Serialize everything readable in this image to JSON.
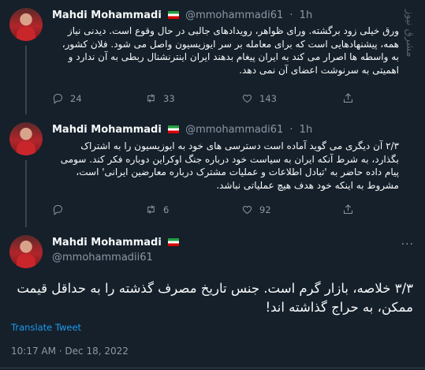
{
  "tweets": [
    {
      "name": "Mahdi Mohammadi",
      "handle": "@mmohammadi61",
      "time": "1h",
      "text": "ورق خیلی زود برگشته. ورای ظواهر، رویدادهای جالبی در حال وقوع است. دیدنی نیاز همه، پیشنهادهایی است که برای معامله بر سر ایوزیسیون واصل می شود. فلان کشور، به واسطه ها اصرار می کند به ایران پیغام بدهند ایران اینترنشنال ربطی به آن ندارد و اهمیتی به سرنوشت اعضای آن نمی دهد.",
      "replies": "24",
      "retweets": "33",
      "likes": "143"
    },
    {
      "name": "Mahdi Mohammadi",
      "handle": "@mmohammadi61",
      "time": "1h",
      "text": "۲/۳ آن دیگری می گوید آماده است دسترسی های خود به ایوزیسیون را به اشتراک بگذارد، به شرط آنکه ایران به سیاست خود درباره جنگ اوکراین دوباره فکر کند. سومی پیام داده حاضر به 'تبادل اطلاعات و عملیات مشترک درباره معارضین ایرانی' است، مشروط به اینکه خود هدف هیچ عملیاتی نباشد.",
      "replies": "",
      "retweets": "6",
      "likes": "92"
    },
    {
      "name": "Mahdi Mohammadi",
      "handle": "@mmohammadii61",
      "text": "۳/۳ خلاصه، بازار گرم است. جنس تاریخ مصرف گذشته را به حداقل قیمت ممکن، به حراج گذاشته اند!",
      "translate": "Translate Tweet",
      "timestamp": "10:17 AM · Dec 18, 2022"
    }
  ],
  "watermark": "مشرق نیوز",
  "icons": [
    "reply-icon",
    "retweet-icon",
    "like-icon",
    "share-icon",
    "more-icon"
  ],
  "colors": {
    "background": "#15202b",
    "text": "#f7f9f9",
    "muted": "#8b98a5",
    "link": "#1d9bf0",
    "border": "#38444d"
  }
}
